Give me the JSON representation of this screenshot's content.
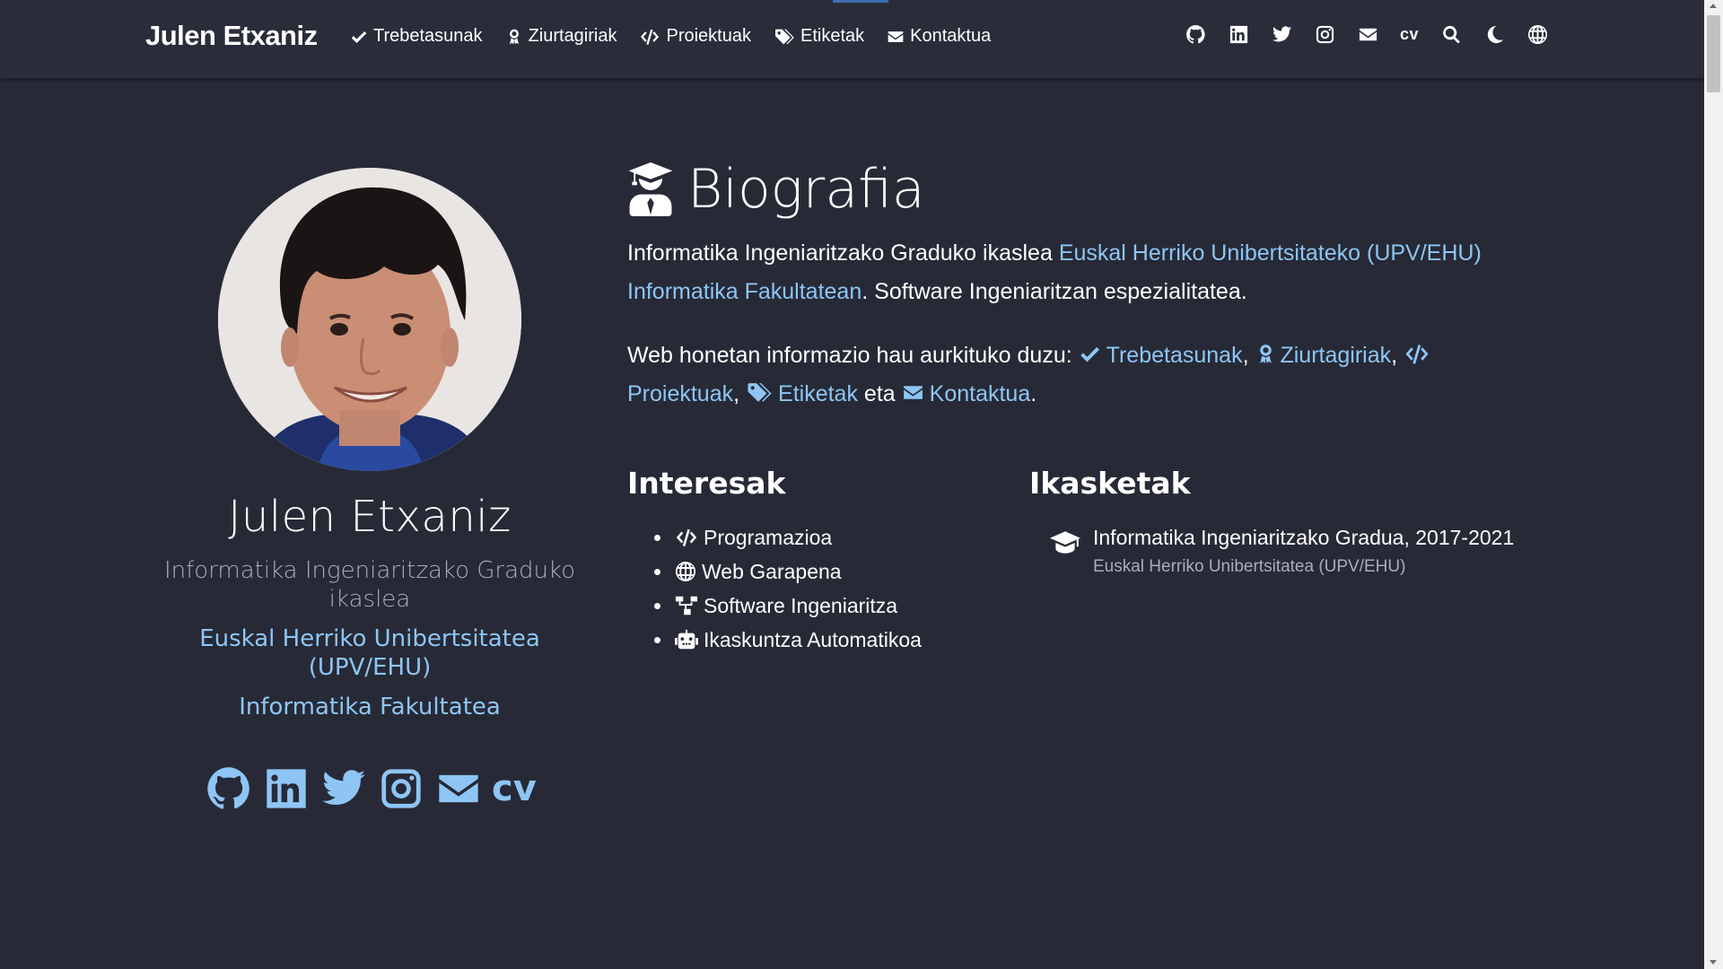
{
  "navbar": {
    "brand": "Julen Etxaniz",
    "links": [
      {
        "label": "Trebetasunak",
        "icon": "check-icon"
      },
      {
        "label": "Ziurtagiriak",
        "icon": "certificate-icon"
      },
      {
        "label": "Proiektuak",
        "icon": "code-icon"
      },
      {
        "label": "Etiketak",
        "icon": "tags-icon"
      },
      {
        "label": "Kontaktua",
        "icon": "envelope-icon"
      }
    ],
    "right_icons": [
      "github-icon",
      "linkedin-icon",
      "twitter-icon",
      "instagram-icon",
      "envelope-icon",
      "cv",
      "search-icon",
      "moon-icon",
      "globe-icon"
    ],
    "cv_label": "cv"
  },
  "profile": {
    "name": "Julen Etxaniz",
    "role": "Informatika Ingeniaritzako Graduko ikaslea",
    "organization": "Euskal Herriko Unibertsitatea (UPV/EHU)",
    "faculty": "Informatika Fakultatea",
    "social": [
      "github-icon",
      "linkedin-icon",
      "twitter-icon",
      "instagram-icon",
      "envelope-icon",
      "cv"
    ],
    "cv_label": "cv"
  },
  "bio": {
    "title": "Biografia",
    "p1_text1": "Informatika Ingeniaritzako Graduko ikaslea ",
    "p1_link": "Euskal Herriko Unibertsitateko (UPV/EHU) Informatika Fakultatean",
    "p1_text2": ". Software Ingeniaritzan espezialitatea.",
    "p2_text1": "Web honetan informazio hau aurkituko duzu: ",
    "p2_links": [
      "Trebetasunak",
      "Ziurtagiriak",
      "Proiektuak",
      "Etiketak",
      "Kontaktua"
    ],
    "p2_sep": ",",
    "p2_and": "eta",
    "p2_end": "."
  },
  "interests": {
    "title": "Interesak",
    "items": [
      {
        "label": "Programazioa",
        "icon": "code-icon"
      },
      {
        "label": "Web Garapena",
        "icon": "globe-icon"
      },
      {
        "label": "Software Ingeniaritza",
        "icon": "sitemap-icon"
      },
      {
        "label": "Ikaskuntza Automatikoa",
        "icon": "robot-icon"
      }
    ]
  },
  "education": {
    "title": "Ikasketak",
    "course": "Informatika Ingeniaritzako Gradua, 2017-2021",
    "institution": "Euskal Herriko Unibertsitatea (UPV/EHU)"
  },
  "colors": {
    "background": "#272a36",
    "navbar": "#2a2d39",
    "link": "#8ec5f5",
    "muted": "#a9adb8"
  }
}
